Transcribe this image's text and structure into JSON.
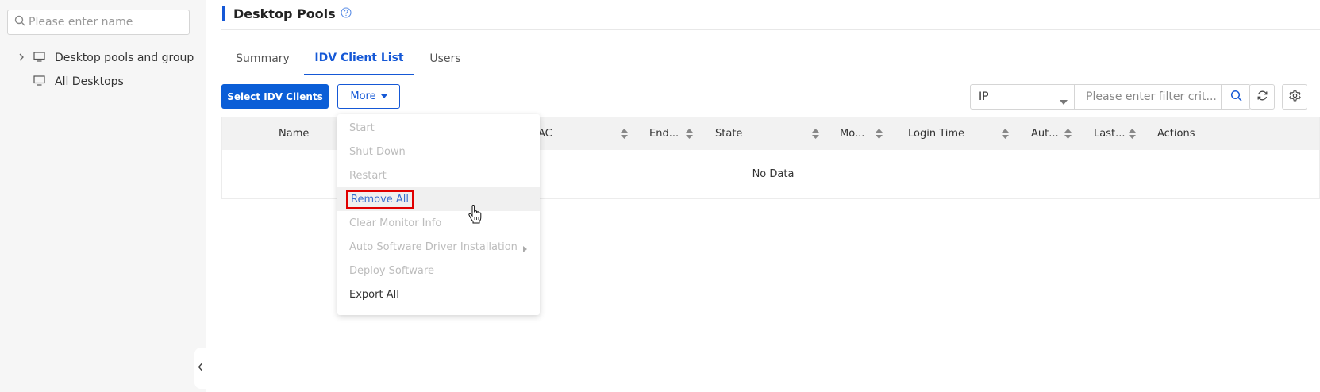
{
  "sidebar": {
    "search_placeholder": "Please enter name",
    "items": [
      {
        "label": "Desktop pools and group",
        "expandable": true,
        "icon": "monitor-icon"
      },
      {
        "label": "All Desktops",
        "expandable": false,
        "icon": "monitor-icon"
      }
    ]
  },
  "header": {
    "title": "Desktop Pools"
  },
  "tabs": [
    {
      "label": "Summary",
      "active": false
    },
    {
      "label": "IDV Client List",
      "active": true
    },
    {
      "label": "Users",
      "active": false
    }
  ],
  "toolbar": {
    "select_label": "Select IDV Clients",
    "more_label": "More",
    "filter_field": "IP",
    "filter_placeholder": "Please enter filter crit..."
  },
  "table": {
    "columns": [
      "Name",
      "AC",
      "End...",
      "State",
      "Mo...",
      "Login Time",
      "Aut...",
      "Last...",
      "Actions"
    ],
    "empty_text": "No Data"
  },
  "more_menu": {
    "items": [
      {
        "label": "Start",
        "enabled": false
      },
      {
        "label": "Shut Down",
        "enabled": false
      },
      {
        "label": "Restart",
        "enabled": false
      },
      {
        "label": "Remove All",
        "enabled": true,
        "highlighted": true
      },
      {
        "label": "Clear Monitor Info",
        "enabled": false
      },
      {
        "label": "Auto Software Driver Installation",
        "enabled": false,
        "submenu": true
      },
      {
        "label": "Deploy Software",
        "enabled": false
      },
      {
        "label": "Export All",
        "enabled": true
      }
    ]
  },
  "colors": {
    "primary": "#0b5ed7",
    "highlight_box": "#e00000",
    "sidebar_bg": "#f6f6f6"
  }
}
